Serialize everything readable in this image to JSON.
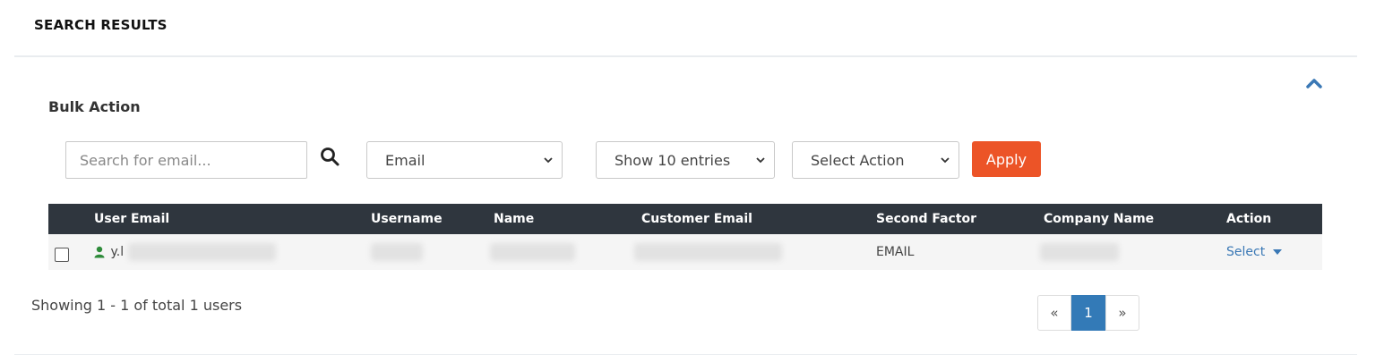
{
  "header": {
    "title": "SEARCH RESULTS"
  },
  "bulk": {
    "label": "Bulk Action",
    "search_placeholder": "Search for email...",
    "filter_select": "Email",
    "entries_select": "Show 10 entries",
    "action_select": "Select Action",
    "apply_label": "Apply"
  },
  "table": {
    "headers": [
      "User Email",
      "Username",
      "Name",
      "Customer Email",
      "Second Factor",
      "Company Name",
      "Action"
    ],
    "rows": [
      {
        "user_email": "y.l",
        "second_factor": "EMAIL",
        "action": "Select"
      }
    ]
  },
  "footer": {
    "summary": "Showing 1 - 1 of total 1 users",
    "pagination": {
      "prev": "«",
      "current": "1",
      "next": "»"
    }
  },
  "colors": {
    "apply": "#ec5427",
    "header_bg": "#2f363e",
    "link": "#3a78b5",
    "active_page": "#337ab7",
    "user_icon": "#2e8b3a"
  },
  "icons": [
    "chevron-up-icon",
    "search-icon",
    "chevron-down-icon",
    "user-icon",
    "caret-down-icon"
  ]
}
